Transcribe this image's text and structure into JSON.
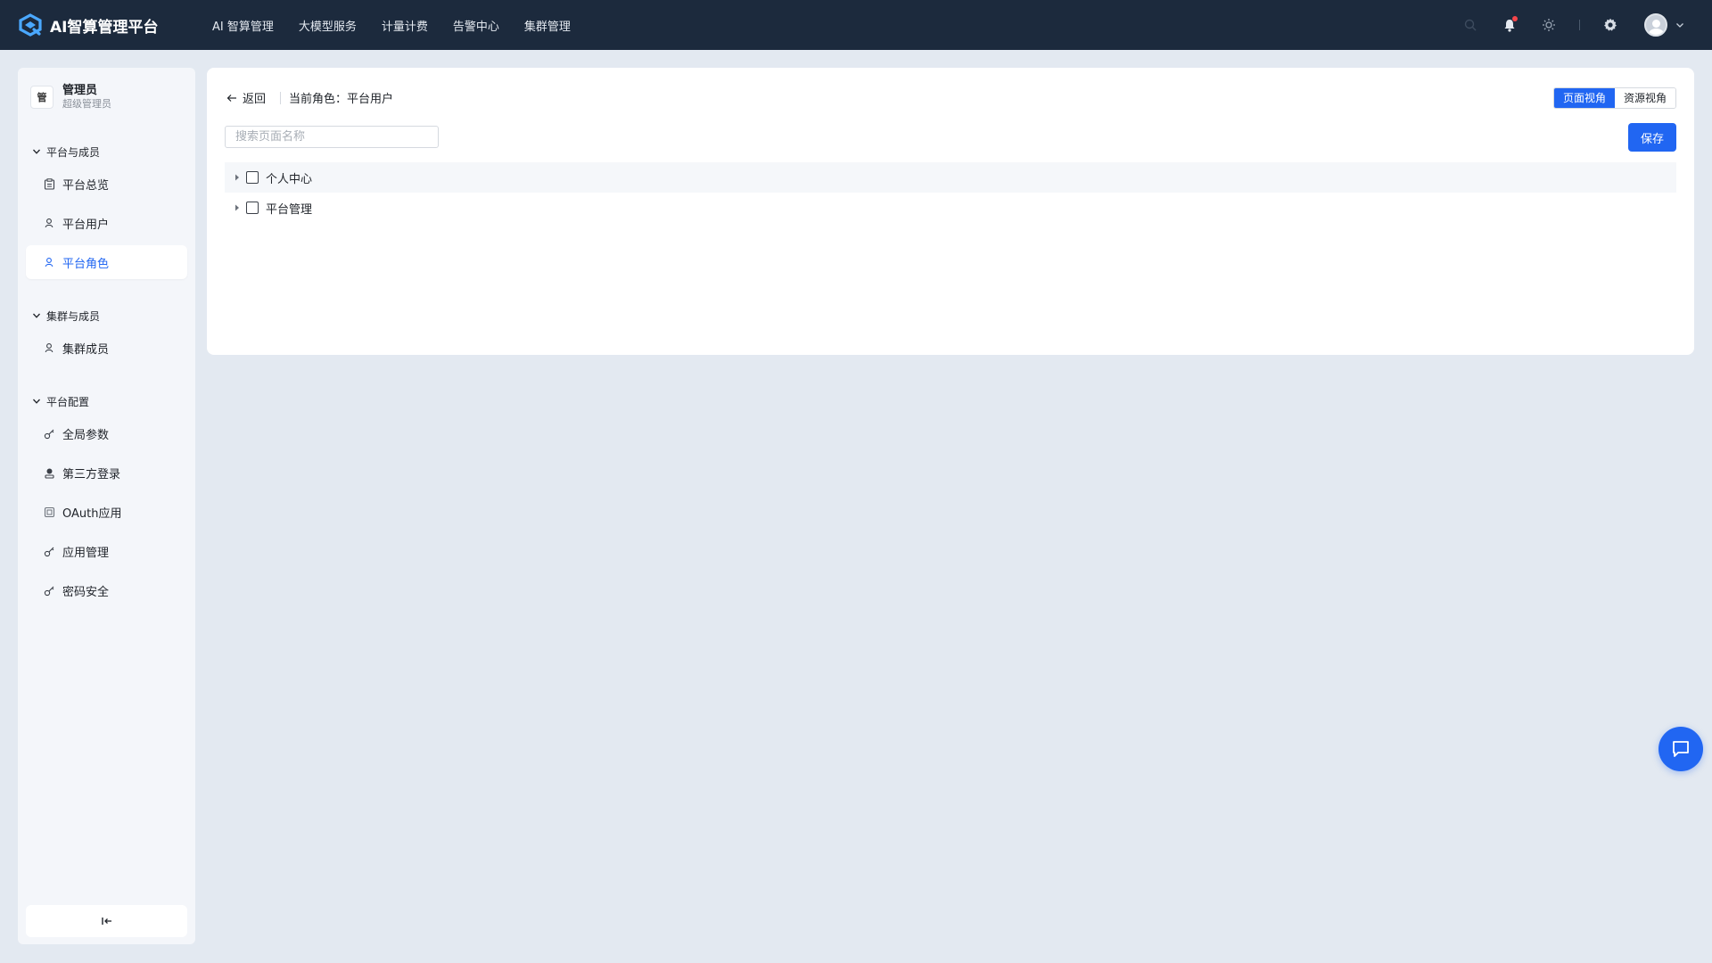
{
  "header": {
    "title": "AI智算管理平台",
    "nav": [
      {
        "label": "AI 智算管理"
      },
      {
        "label": "大模型服务"
      },
      {
        "label": "计量计费"
      },
      {
        "label": "告警中心"
      },
      {
        "label": "集群管理"
      }
    ]
  },
  "sidebar": {
    "user": {
      "badge": "管",
      "name": "管理员",
      "role": "超级管理员"
    },
    "groups": [
      {
        "title": "平台与成员",
        "items": [
          {
            "label": "平台总览",
            "icon": "clipboard-icon"
          },
          {
            "label": "平台用户",
            "icon": "user-icon"
          },
          {
            "label": "平台角色",
            "icon": "user-role-icon",
            "active": true
          }
        ]
      },
      {
        "title": "集群与成员",
        "items": [
          {
            "label": "集群成员",
            "icon": "user-icon"
          }
        ]
      },
      {
        "title": "平台配置",
        "items": [
          {
            "label": "全局参数",
            "icon": "key-icon"
          },
          {
            "label": "第三方登录",
            "icon": "login-icon"
          },
          {
            "label": "OAuth应用",
            "icon": "app-icon"
          },
          {
            "label": "应用管理",
            "icon": "key-icon"
          },
          {
            "label": "密码安全",
            "icon": "key-icon"
          }
        ]
      }
    ],
    "collapse_icon": "collapse-sidebar-icon"
  },
  "main": {
    "back_label": "返回",
    "role_label": "当前角色：平台用户",
    "view_toggle": [
      {
        "label": "页面视角",
        "active": true
      },
      {
        "label": "资源视角",
        "active": false
      }
    ],
    "search": {
      "placeholder": "搜索页面名称",
      "value": ""
    },
    "save_label": "保存",
    "tree": [
      {
        "label": "个人中心",
        "checked": false
      },
      {
        "label": "平台管理",
        "checked": false
      }
    ]
  },
  "colors": {
    "accent": "#2166f2",
    "topbar": "#1c2a3d",
    "background": "#e3e9f1"
  }
}
